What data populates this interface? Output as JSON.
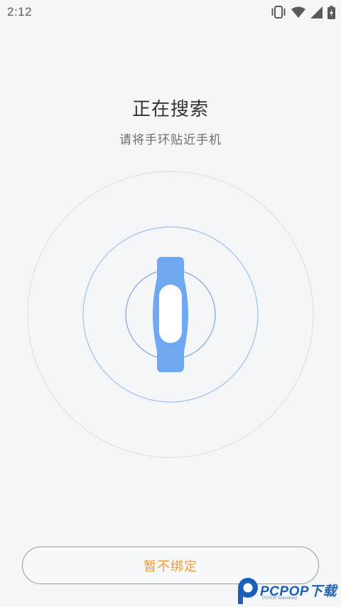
{
  "status_bar": {
    "time": "2:12",
    "icons": [
      "vibrate-icon",
      "wifi-icon",
      "signal-icon",
      "battery-charging-icon"
    ]
  },
  "search": {
    "title": "正在搜索",
    "subtitle": "请将手环贴近手机"
  },
  "illustration": {
    "icon": "fitness-band-icon",
    "colors": {
      "band": "#6fa8f0",
      "band_face": "#ffffff",
      "inner_ring": "#7aa6e6",
      "middle_ring": "#9cc0f2",
      "outer_ring": "#dde2ea"
    }
  },
  "actions": {
    "skip_label": "暂不绑定",
    "skip_color": "#f29a2e"
  },
  "watermark": {
    "text": "PCPOP下载",
    "subtext": "PCPOP Download",
    "icon": "pcpop-logo-icon"
  }
}
